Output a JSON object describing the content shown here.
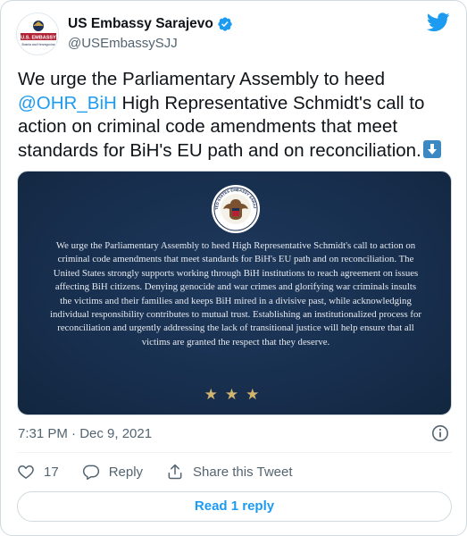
{
  "author": {
    "name": "US Embassy Sarajevo",
    "handle": "@USEmbassySJJ",
    "avatar_text": "U.S. EMBASSY",
    "avatar_sub": "Bosnia and Herzegovina"
  },
  "tweet": {
    "text_part1": "We urge the Parliamentary Assembly to heed",
    "mention": "@OHR_BiH",
    "text_part2": "  High Representative Schmidt's call to action on criminal code amendments that meet standards for BiH's EU path and on reconciliation.",
    "emoji": "arrow-down-emoji"
  },
  "media": {
    "seal_label": "UNITED STATES EMBASSY SARAJEVO",
    "statement": "We urge the Parliamentary Assembly to heed High Representative Schmidt's call to action on criminal code amendments that meet standards for BiH's EU path and on reconciliation. The United States strongly supports working through BiH institutions to reach agreement on issues affecting BiH citizens. Denying genocide and war crimes and glorifying war criminals insults the victims and their families and keeps BiH mired in a divisive past, while acknowledging individual responsibility contributes to mutual trust. Establishing an institutionalized process for reconciliation and urgently addressing the lack of transitional justice will help ensure that all victims are granted the respect that they deserve.",
    "stars": "★★★"
  },
  "timestamp": "7:31 PM · Dec 9, 2021",
  "actions": {
    "like_count": "17",
    "reply_label": "Reply",
    "share_label": "Share this Tweet"
  },
  "read_replies_label": "Read 1 reply",
  "colors": {
    "accent": "#1d9bf0",
    "text": "#0f1419",
    "muted": "#536471",
    "media_bg": "#172e4d",
    "stars": "#d2b46f"
  },
  "icons": [
    "verified-badge-icon",
    "twitter-bird-icon",
    "info-icon",
    "heart-icon",
    "reply-icon",
    "share-icon",
    "arrow-down-emoji"
  ]
}
